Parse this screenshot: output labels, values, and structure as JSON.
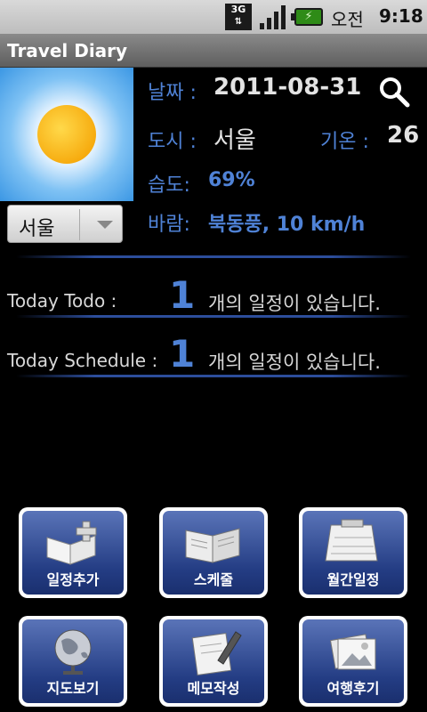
{
  "status_bar": {
    "network": "3G",
    "ampm": "오전",
    "time": "9:18"
  },
  "app": {
    "title": "Travel Diary"
  },
  "weather": {
    "date_label": "날짜 :",
    "date": "2011-08-31",
    "city_label": "도시 :",
    "city": "서울",
    "temp_label": "기온 :",
    "temp": "26",
    "humidity_label": "습도:",
    "humidity": "69%",
    "wind_label": "바람:",
    "wind": "북동풍, 10 km/h",
    "icon": "sunny-icon"
  },
  "city_select": {
    "selected": "서울"
  },
  "today": {
    "todo_label": "Today Todo :",
    "todo_count": "1",
    "todo_suffix": "개의 일정이 있습니다.",
    "schedule_label": "Today Schedule :",
    "schedule_count": "1",
    "schedule_suffix": "개의 일정이 있습니다."
  },
  "menu": [
    {
      "label": "일정추가",
      "icon": "add-schedule-icon"
    },
    {
      "label": "스케줄",
      "icon": "schedule-book-icon"
    },
    {
      "label": "월간일정",
      "icon": "calendar-icon"
    },
    {
      "label": "지도보기",
      "icon": "globe-icon"
    },
    {
      "label": "메모작성",
      "icon": "memo-pen-icon"
    },
    {
      "label": "여행후기",
      "icon": "photos-icon"
    }
  ],
  "colors": {
    "accent": "#4f82d6",
    "tile": "#243d84"
  }
}
